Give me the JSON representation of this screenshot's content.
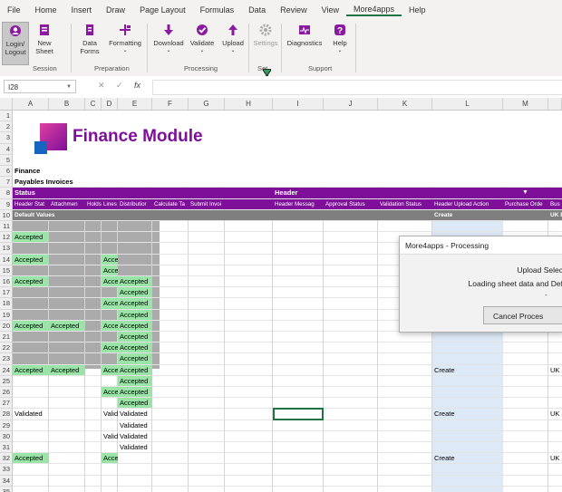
{
  "menu": [
    "File",
    "Home",
    "Insert",
    "Draw",
    "Page Layout",
    "Formulas",
    "Data",
    "Review",
    "View",
    "More4apps",
    "Help"
  ],
  "ribbon": {
    "buttons": {
      "login": "Login/\nLogout",
      "newsheet": "New\nSheet",
      "dataforms": "Data\nForms",
      "formatting": "Formatting",
      "download": "Download",
      "validate": "Validate",
      "upload": "Upload",
      "settings": "Settings",
      "diagnostics": "Diagnostics",
      "help": "Help"
    },
    "groups": {
      "session": "Session",
      "preparation": "Preparation",
      "processing": "Processing",
      "settings": "Set",
      "support": "Support"
    }
  },
  "formula_bar": {
    "name_box": "I28",
    "cancel": "✕",
    "enter": "✓",
    "fx": "fx",
    "value": ""
  },
  "columns": [
    "A",
    "B",
    "C",
    "D",
    "E",
    "F",
    "G",
    "H",
    "I",
    "J",
    "K",
    "L",
    "M"
  ],
  "rows": [
    "1",
    "2",
    "3",
    "4",
    "5",
    "6",
    "7",
    "8",
    "9",
    "10",
    "11",
    "12",
    "13",
    "14",
    "15",
    "16",
    "17",
    "18",
    "19",
    "20",
    "21",
    "22",
    "23",
    "24",
    "25",
    "26",
    "27",
    "28",
    "29",
    "30",
    "31",
    "32",
    "33",
    "34",
    "35"
  ],
  "title": "Finance Module",
  "labels": {
    "r6": "Finance",
    "r7": "Payables Invoices",
    "status": "Status",
    "header": "Header",
    "default_values": "Default Values",
    "create": "Create",
    "uk": "UK B"
  },
  "r9_headers": {
    "A": "Header Stat",
    "B": "Attachmen",
    "C": "Holds",
    "D": "Lines Stat",
    "E": "Distributior",
    "F": "Calculate Ta",
    "G": "Submit Invoi",
    "I": "Header Messag",
    "J": "Approval Status",
    "K": "Validation Status",
    "L": "Header Upload Action",
    "M": "Purchase Orde",
    "N": "Bus"
  },
  "status_values": {
    "accepted": "Accepted",
    "validated": "Validated"
  },
  "dialog": {
    "title": "More4apps - Processing",
    "line1": "Upload Selec",
    "line2": "Loading sheet data and Def",
    "line3": "-",
    "button": "Cancel Proces"
  },
  "colors": {
    "accent": "#7d0f99",
    "accepted": "#9be4a8",
    "excel_green": "#217346"
  }
}
